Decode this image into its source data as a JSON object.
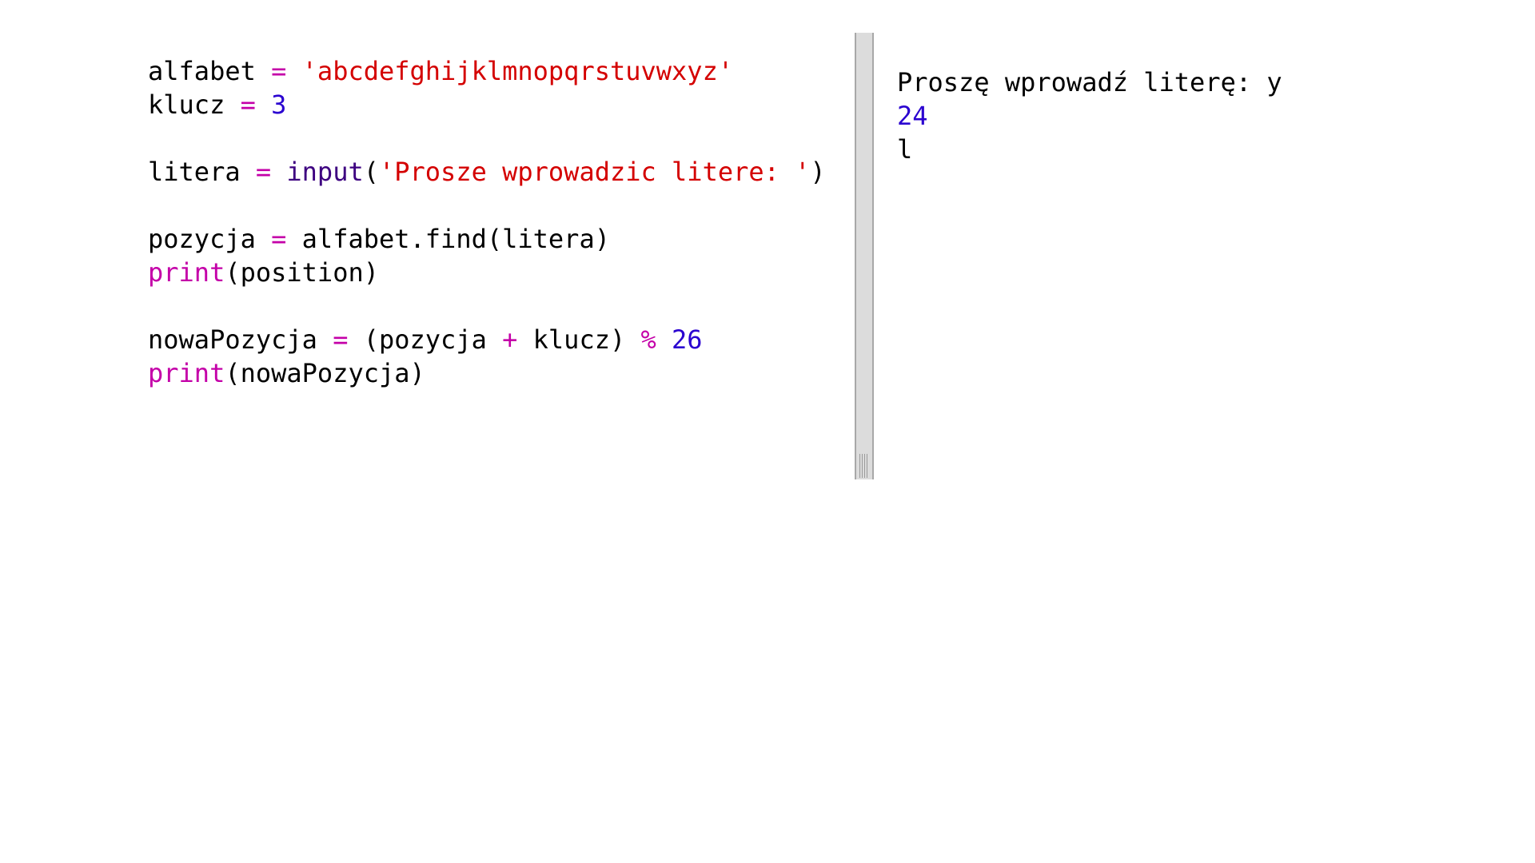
{
  "editor": {
    "lines": [
      {
        "tokens": [
          {
            "t": "alfabet ",
            "k": "plain"
          },
          {
            "t": "=",
            "k": "op"
          },
          {
            "t": " ",
            "k": "plain"
          },
          {
            "t": "'abcdefghijklmnopqrstuvwxyz'",
            "k": "str"
          }
        ]
      },
      {
        "tokens": [
          {
            "t": "klucz ",
            "k": "plain"
          },
          {
            "t": "=",
            "k": "op"
          },
          {
            "t": " ",
            "k": "plain"
          },
          {
            "t": "3",
            "k": "num"
          }
        ]
      },
      {
        "tokens": []
      },
      {
        "tokens": [
          {
            "t": "litera ",
            "k": "plain"
          },
          {
            "t": "=",
            "k": "op"
          },
          {
            "t": " ",
            "k": "plain"
          },
          {
            "t": "input",
            "k": "builtin"
          },
          {
            "t": "(",
            "k": "plain"
          },
          {
            "t": "'Prosze wprowadzic litere: '",
            "k": "str"
          },
          {
            "t": ")",
            "k": "plain"
          }
        ]
      },
      {
        "tokens": []
      },
      {
        "tokens": [
          {
            "t": "pozycja ",
            "k": "plain"
          },
          {
            "t": "=",
            "k": "op"
          },
          {
            "t": " alfabet.find(litera)",
            "k": "plain"
          }
        ]
      },
      {
        "tokens": [
          {
            "t": "print",
            "k": "kw"
          },
          {
            "t": "(position)",
            "k": "plain"
          }
        ]
      },
      {
        "tokens": []
      },
      {
        "tokens": [
          {
            "t": "nowaPozycja ",
            "k": "plain"
          },
          {
            "t": "=",
            "k": "op"
          },
          {
            "t": " (pozycja ",
            "k": "plain"
          },
          {
            "t": "+",
            "k": "op"
          },
          {
            "t": " klucz) ",
            "k": "plain"
          },
          {
            "t": "%",
            "k": "op"
          },
          {
            "t": " ",
            "k": "plain"
          },
          {
            "t": "26",
            "k": "num"
          }
        ]
      },
      {
        "tokens": [
          {
            "t": "print",
            "k": "kw"
          },
          {
            "t": "(nowaPozycja)",
            "k": "plain"
          }
        ]
      }
    ]
  },
  "output": {
    "lines": [
      {
        "text": "Proszę wprowadź literę: y",
        "kind": "text"
      },
      {
        "text": "24",
        "kind": "num"
      },
      {
        "text": "l",
        "kind": "text"
      }
    ]
  },
  "colors": {
    "string": "#d40000",
    "number": "#2a00d0",
    "operator": "#c400a8",
    "keyword": "#c400a8",
    "builtin": "#3d0080",
    "splitter": "#dcdcdc"
  }
}
